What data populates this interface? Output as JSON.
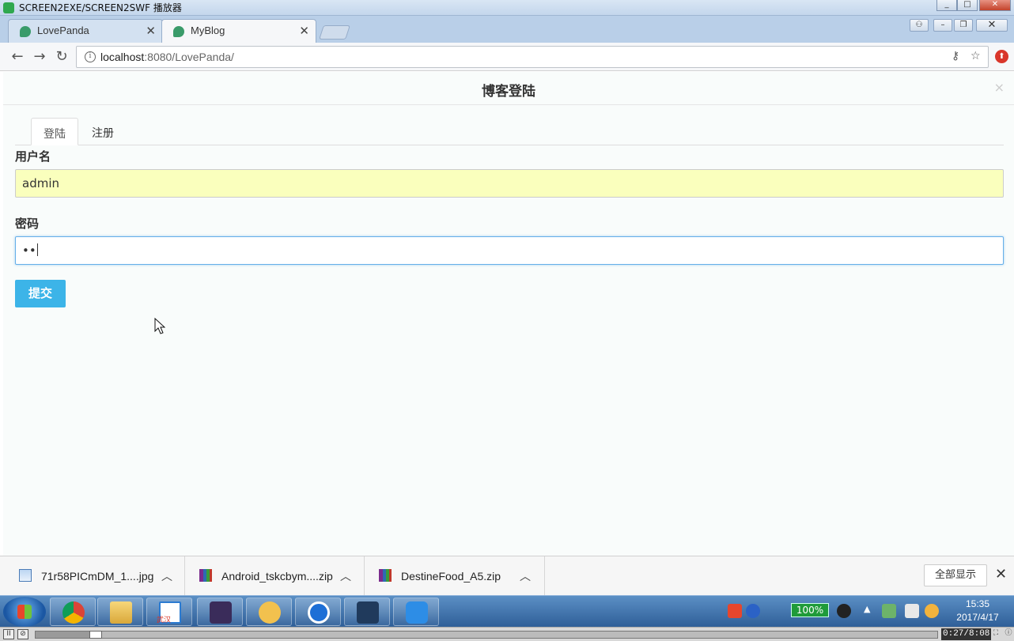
{
  "window": {
    "title": "SCREEN2EXE/SCREEN2SWF 播放器"
  },
  "browser": {
    "tabs": [
      {
        "label": "LovePanda",
        "active": false
      },
      {
        "label": "MyBlog",
        "active": true
      }
    ],
    "url_host": "localhost",
    "url_rest": ":8080/LovePanda/"
  },
  "modal": {
    "title": "博客登陆",
    "close": "×",
    "tabs": [
      {
        "label": "登陆",
        "active": true
      },
      {
        "label": "注册",
        "active": false
      }
    ],
    "username_label": "用户名",
    "username_value": "admin",
    "password_label": "密码",
    "password_value": "••",
    "submit_label": "提交"
  },
  "downloads": {
    "items": [
      {
        "name": "71r58PICmDM_1....jpg",
        "type": "image"
      },
      {
        "name": "Android_tskcbym....zip",
        "type": "zip"
      },
      {
        "name": "DestineFood_A5.zip",
        "type": "zip"
      }
    ],
    "show_all": "全部显示"
  },
  "taskbar": {
    "apps": [
      "chrome-icon",
      "explorer-icon",
      "design-code-icon",
      "java-ee-ide-icon",
      "yellow-app-icon",
      "teamviewer-icon",
      "s-app-icon",
      "w-app-icon"
    ],
    "design_text": "武汉",
    "battery": "100%",
    "time": "15:35",
    "date": "2017/4/17"
  },
  "player": {
    "time": "0:27/8:08",
    "progress": 0.06
  }
}
